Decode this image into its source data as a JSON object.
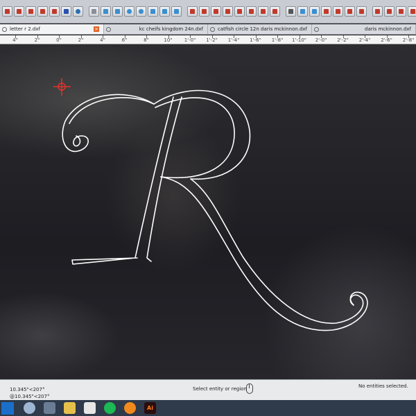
{
  "tabs": [
    {
      "label": "letter r 2.dxf",
      "active": true
    },
    {
      "label": "kc cheifs kingdom 24n.dxf",
      "active": false
    },
    {
      "label": "catfish circle 12n daris mckinnon.dxf",
      "active": false
    },
    {
      "label": "daris mckinnon.dxf",
      "active": false
    }
  ],
  "tab_close_glyph": "×",
  "ruler": {
    "labels": [
      "4\"",
      "2\"",
      "0\"",
      "2\"",
      "4\"",
      "6\"",
      "8\"",
      "10\"",
      "1'-0\"",
      "1'-2\"",
      "1'-4\"",
      "1'-6\"",
      "1'-8\"",
      "1'-10\"",
      "2'-0\"",
      "2'-2\"",
      "2'-4\"",
      "2'-6\"",
      "2'-8\""
    ]
  },
  "status": {
    "coord_line1": "10.345\"<207°",
    "coord_line2": "@10.345\"<207°",
    "prompt": "Select entity or region",
    "selection_info": "No entities selected."
  },
  "taskbar": {
    "apps": [
      "start-menu",
      "search",
      "edge-browser",
      "file-explorer",
      "store",
      "spotify",
      "media-player",
      "illustrator"
    ],
    "illustrator_label": "Ai"
  },
  "colors": {
    "letter_outline": "#ffffff",
    "origin_marker": "#e0342a",
    "canvas_bg": "#1f1f24"
  },
  "icons": [
    "origin-crosshair-icon",
    "mouse-icon",
    "windows-start-icon",
    "search-icon",
    "spotify-icon",
    "illustrator-icon"
  ]
}
